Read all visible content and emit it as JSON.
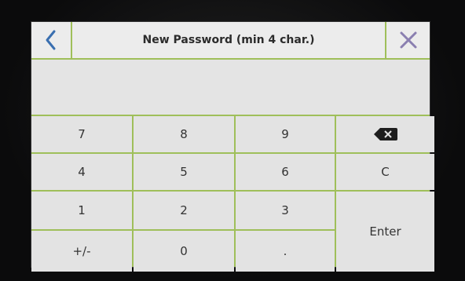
{
  "dialog": {
    "title": "New Password (min 4 char.)"
  },
  "input": {
    "value": ""
  },
  "keypad": {
    "rows": [
      [
        "7",
        "8",
        "9"
      ],
      [
        "4",
        "5",
        "6",
        "C"
      ],
      [
        "1",
        "2",
        "3"
      ],
      [
        "+/-",
        "0",
        "."
      ]
    ],
    "enter_label": "Enter"
  },
  "colors": {
    "accent_border": "#9fbf5a",
    "icon_blue": "#3a6fb0",
    "close_purple": "#8a7fb0"
  },
  "icons": {
    "back": "chevron-left-icon",
    "close": "close-icon",
    "backspace": "backspace-icon"
  }
}
